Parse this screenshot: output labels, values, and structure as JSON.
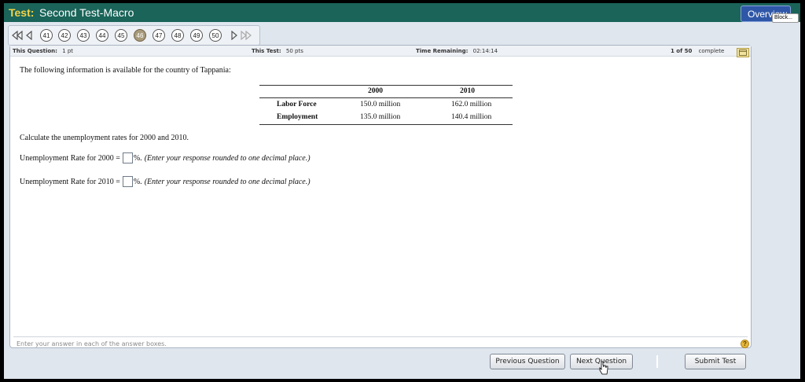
{
  "header": {
    "test_label": "Test:",
    "test_name": "Second Test-Macro",
    "overview_label": "Overview",
    "tooltip": "Block..."
  },
  "nav": {
    "question_numbers": [
      "41",
      "42",
      "43",
      "44",
      "45",
      "46",
      "47",
      "48",
      "49",
      "50"
    ],
    "current": "46"
  },
  "info": {
    "this_question_label": "This Question:",
    "this_question_value": "1 pt",
    "this_test_label": "This Test:",
    "this_test_value": "50 pts",
    "time_label": "Time Remaining:",
    "time_value": "02:14:14",
    "progress_count": "1 of 50",
    "progress_label": "complete"
  },
  "question": {
    "intro": "The following information is available for the country of Tappania:",
    "table": {
      "headers": [
        "",
        "2000",
        "2010"
      ],
      "rows": [
        {
          "label": "Labor Force",
          "y2000": "150.0 million",
          "y2010": "162.0 million"
        },
        {
          "label": "Employment",
          "y2000": "135.0 million",
          "y2010": "140.4 million"
        }
      ]
    },
    "prompt": "Calculate the unemployment rates for 2000 and 2010.",
    "q1_label": "Unemployment Rate for 2000 =",
    "q2_label": "Unemployment Rate for 2010 =",
    "percent": "%.",
    "hint": "(Enter your response rounded to one decimal place.)"
  },
  "footer": {
    "instruction": "Enter your answer in each of the answer boxes.",
    "help_glyph": "?"
  },
  "buttons": {
    "previous": "Previous Question",
    "next": "Next Question",
    "submit": "Submit Test"
  },
  "colors": {
    "titlebar": "#1a6459",
    "title_accent": "#f3d34a",
    "overview": "#2f57a8"
  }
}
